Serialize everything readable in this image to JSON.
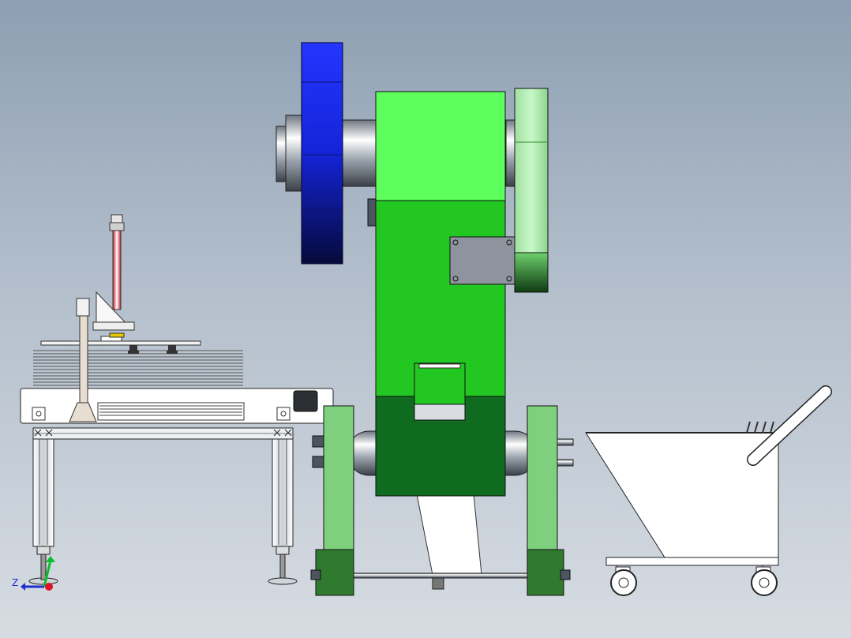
{
  "view": {
    "background_top": "#8e9fb3",
    "background_bottom": "#d7dce2"
  },
  "colors": {
    "flywheel": "#1a2cff",
    "press_upper": "#5cff5c",
    "press_lower": "#22c722",
    "press_base": "#0f6b1f",
    "press_legs": "#7ecf7e",
    "belt_guard": "#c6f7c6",
    "plate": "#8d949e",
    "bin": "#ffffff",
    "frame": "#e6e9ee"
  },
  "axis_triad": {
    "z_label": "Z"
  },
  "model_parts": [
    "flywheel",
    "press-frame",
    "belt-guard",
    "press-legs",
    "feeder-table",
    "pneumatic-cylinder",
    "sheet-stack",
    "scrap-bin",
    "caster-wheel"
  ]
}
